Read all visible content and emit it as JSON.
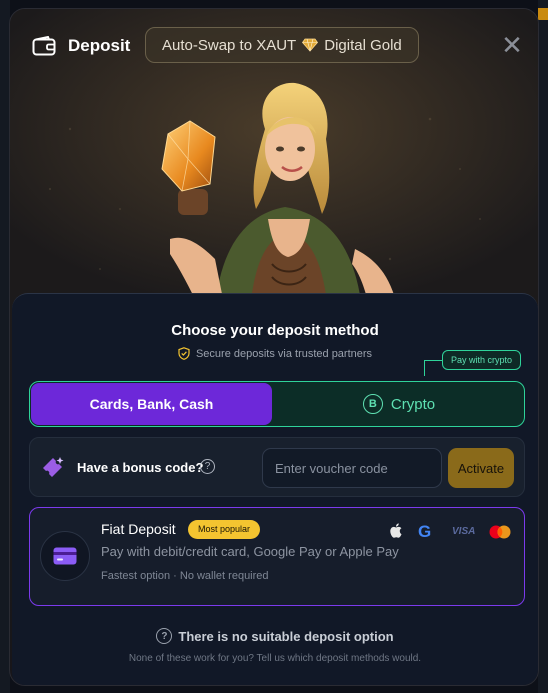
{
  "header": {
    "title": "Deposit",
    "chip_left": "Auto-Swap to XAUT",
    "chip_right": "Digital Gold",
    "close_label": "✕"
  },
  "method": {
    "heading": "Choose your deposit method",
    "secure_text": "Secure deposits via trusted partners",
    "tooltip": "Pay with crypto",
    "tabs": [
      {
        "label": "Cards, Bank, Cash",
        "selected": true
      },
      {
        "label": "Crypto",
        "selected": false
      }
    ],
    "crypto_symbol": "B"
  },
  "bonus": {
    "label": "Have a bonus code?",
    "help": "?",
    "placeholder": "Enter voucher code",
    "button": "Activate"
  },
  "fiat": {
    "title": "Fiat Deposit",
    "badge": "Most popular",
    "description": "Pay with debit/credit card, Google Pay or Apple Pay",
    "subtext": "Fastest option · No wallet required",
    "payment_icons": [
      "apple-icon",
      "google-icon",
      "visa-icon",
      "mastercard-icon"
    ],
    "visa_text": "VISA",
    "google_text": "G"
  },
  "footer": {
    "title": "There is no suitable deposit option",
    "subtitle": "None of these work for you? Tell us which deposit methods would."
  },
  "colors": {
    "accent_purple": "#6d28d9",
    "crypto_green": "#2fd39a",
    "activate_gold": "#8a6a1a",
    "badge_yellow": "#f4c430"
  }
}
